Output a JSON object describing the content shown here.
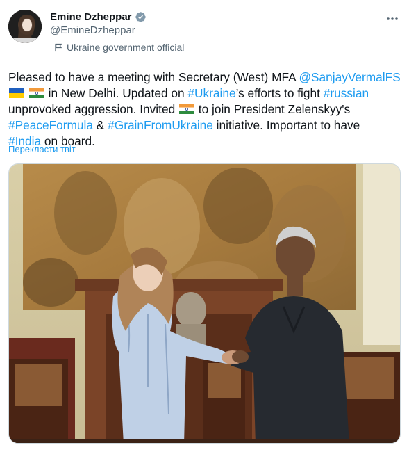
{
  "author": {
    "display_name": "Emine Dzheppar",
    "handle": "@EmineDzheppar",
    "affiliation": "Ukraine government official",
    "avatar_icon": "avatar-photo",
    "verified_icon": "verified-badge-icon"
  },
  "tweet": {
    "t1": "Pleased to have a meeting with Secretary (West) MFA ",
    "mention": "@SanjayVermalFS",
    "t2": " in New Delhi. Updated on ",
    "hashtag_ukraine": "#Ukraine",
    "t3": "’s efforts to fight ",
    "hashtag_russian": "#russian",
    "t4": "unprovoked aggression. Invited ",
    "t5": " to join President Zelenskyy's",
    "hashtag_peace": "#PeaceFormula",
    "t6": " & ",
    "hashtag_grain": "#GrainFromUkraine",
    "t7": " initiative. Important to have",
    "hashtag_india": "#India",
    "t8": " on board."
  },
  "translate_link": "Перекласти твіт",
  "colors": {
    "link": "#1d9bf0",
    "text": "#0f1419",
    "muted": "#536471",
    "verified": "#829aab"
  },
  "media": {
    "description_icon": "photo"
  }
}
